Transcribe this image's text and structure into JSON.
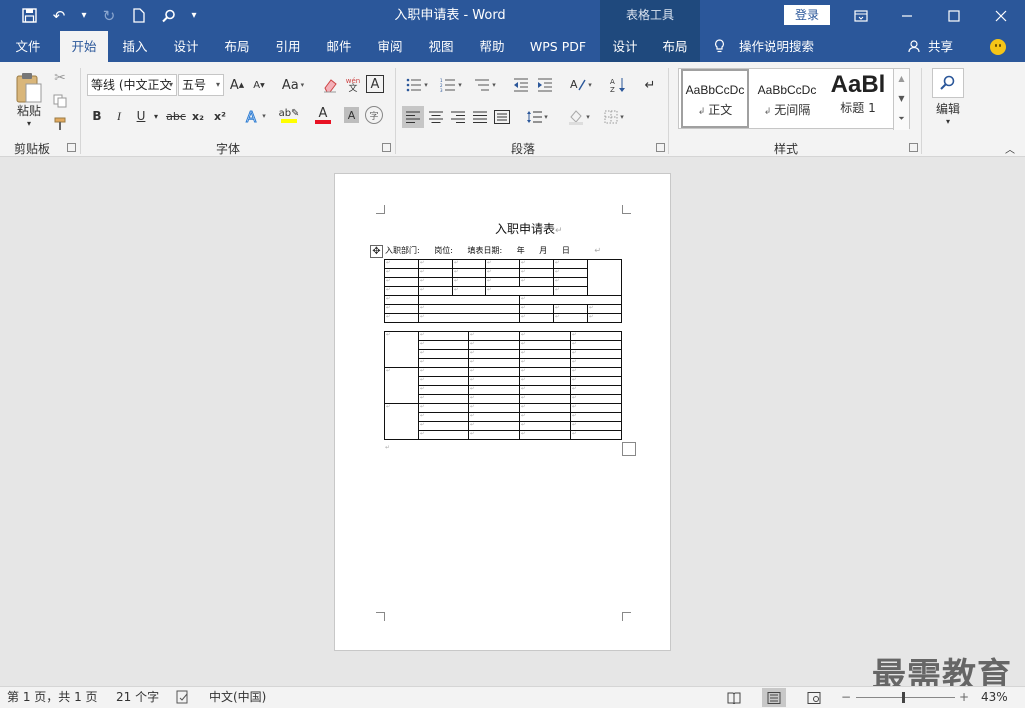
{
  "window": {
    "title": "入职申请表 - Word",
    "context_tools": "表格工具",
    "login": "登录"
  },
  "tabs": {
    "file": "文件",
    "home": "开始",
    "insert": "插入",
    "design": "设计",
    "layout": "布局",
    "references": "引用",
    "mailings": "邮件",
    "review": "审阅",
    "view": "视图",
    "help": "帮助",
    "wps_pdf": "WPS PDF",
    "table_design": "设计",
    "table_layout": "布局",
    "tell_me": "操作说明搜索",
    "share": "共享"
  },
  "ribbon": {
    "clipboard": {
      "paste": "粘贴",
      "label": "剪贴板"
    },
    "font": {
      "name": "等线 (中文正文",
      "size": "五号",
      "label": "字体",
      "grow": "A",
      "shrink": "A",
      "case": "Aa",
      "phonetic": "wén",
      "bold": "B",
      "italic": "I",
      "underline": "U",
      "strike": "abc",
      "sub": "x₂",
      "sup": "x²",
      "color_accent": "#e81123",
      "highlight_color": "#ffff00"
    },
    "paragraph": {
      "label": "段落"
    },
    "styles": {
      "label": "样式",
      "items": [
        {
          "preview": "AaBbCcDc",
          "name": "正文"
        },
        {
          "preview": "AaBbCcDc",
          "name": "无间隔"
        },
        {
          "preview": "AaBl",
          "name": "标题 1"
        }
      ]
    },
    "editing": {
      "label": "编辑"
    }
  },
  "document": {
    "heading": "入职申请表",
    "form_line": {
      "dept": "入职部门:",
      "position": "岗位:",
      "date": "填表日期:",
      "year": "年",
      "month": "月",
      "day": "日"
    },
    "cell_mark": "↵"
  },
  "status": {
    "page": "第 1 页，共 1 页",
    "words": "21 个字",
    "language": "中文(中国)",
    "zoom": "43%",
    "zoom_minus": "−",
    "zoom_plus": "+"
  },
  "watermark": "最需教育",
  "colors": {
    "accent": "#2b579a",
    "context": "#1f497d",
    "ribbon_bg": "#f3f3f3",
    "workspace": "#e6e6e6"
  }
}
